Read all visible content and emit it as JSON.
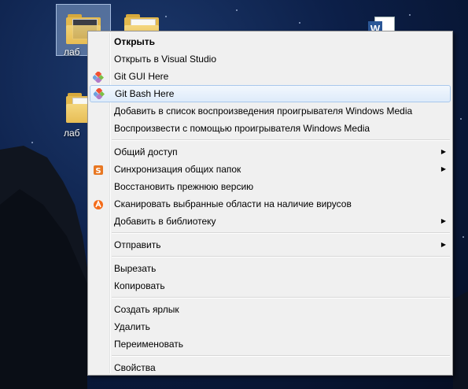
{
  "desktop": {
    "icons": [
      {
        "label": "лаб",
        "type": "folder",
        "selected": true
      },
      {
        "label": "лаб",
        "type": "folder",
        "selected": false
      },
      {
        "label": "",
        "type": "folder",
        "selected": false
      },
      {
        "label": "",
        "type": "word-document",
        "selected": false
      }
    ]
  },
  "context_menu": {
    "items": [
      {
        "label": "Открыть",
        "bold": true
      },
      {
        "label": "Открыть в Visual Studio"
      },
      {
        "label": "Git GUI Here",
        "icon": "git-icon"
      },
      {
        "label": "Git Bash Here",
        "icon": "git-icon",
        "highlighted": true
      },
      {
        "label": "Добавить в список воспроизведения проигрывателя Windows Media"
      },
      {
        "label": "Воспроизвести с помощью проигрывателя Windows Media"
      },
      {
        "label": "Общий доступ",
        "submenu": true
      },
      {
        "label": "Синхронизация общих папок",
        "icon": "sync-icon",
        "submenu": true
      },
      {
        "label": "Восстановить прежнюю версию"
      },
      {
        "label": "Сканировать выбранные области на наличие вирусов",
        "icon": "avast-icon"
      },
      {
        "label": "Добавить в библиотеку",
        "submenu": true
      },
      {
        "label": "Отправить",
        "submenu": true
      },
      {
        "label": "Вырезать"
      },
      {
        "label": "Копировать"
      },
      {
        "label": "Создать ярлык"
      },
      {
        "label": "Удалить"
      },
      {
        "label": "Переименовать"
      },
      {
        "label": "Свойства"
      }
    ],
    "submenu_arrow": "▶"
  },
  "colors": {
    "menu_bg": "#f0f0f0",
    "highlight_bg": "#deebfa",
    "highlight_border": "#a8c8ec",
    "desktop_bg": "#0c1f48"
  }
}
